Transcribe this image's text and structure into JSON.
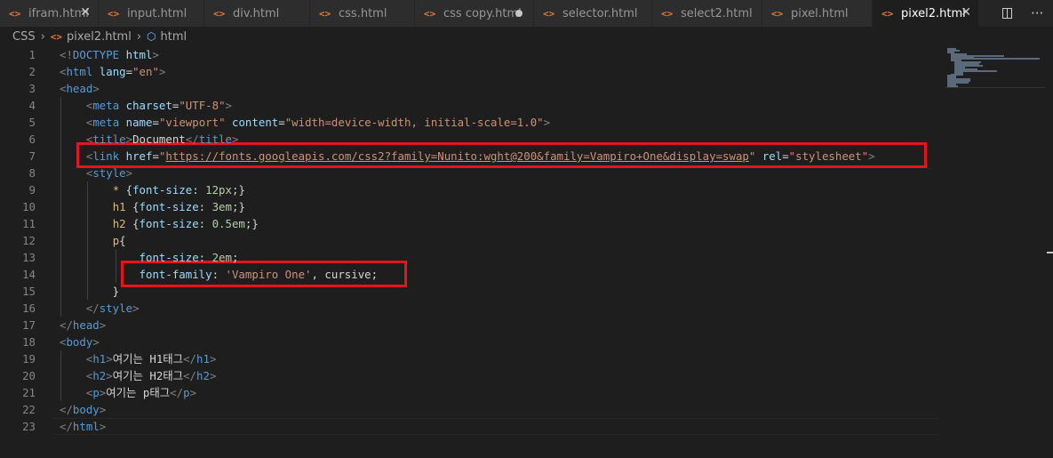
{
  "tabs": [
    {
      "label": "ifram.html",
      "icon": "html-icon",
      "state": "close",
      "width": 111
    },
    {
      "label": "input.html",
      "icon": "html-icon",
      "state": "",
      "width": 119
    },
    {
      "label": "div.html",
      "icon": "html-icon",
      "state": "",
      "width": 119
    },
    {
      "label": "css.html",
      "icon": "html-icon",
      "state": "",
      "width": 118
    },
    {
      "label": "css copy.html",
      "icon": "html-icon",
      "state": "dirty",
      "width": 134
    },
    {
      "label": "selector.html",
      "icon": "html-icon",
      "state": "",
      "width": 133
    },
    {
      "label": "select2.html",
      "icon": "html-icon",
      "state": "",
      "width": 124
    },
    {
      "label": "pixel.html",
      "icon": "html-icon",
      "state": "",
      "width": 124
    },
    {
      "label": "pixel2.html",
      "icon": "html-icon",
      "state": "active",
      "width": 120
    }
  ],
  "tab_close_glyph": "✕",
  "tab_more_glyph": "···",
  "breadcrumb": {
    "folder": "CSS",
    "file": "pixel2.html",
    "symbol": "html"
  },
  "lines": [
    [
      [
        "p",
        "<!"
      ],
      [
        "t",
        "DOCTYPE"
      ],
      [
        "x0",
        " "
      ],
      [
        "a",
        "html"
      ],
      [
        "p",
        ">"
      ]
    ],
    [
      [
        "p",
        "<"
      ],
      [
        "t",
        "html"
      ],
      [
        "x0",
        " "
      ],
      [
        "a",
        "lang"
      ],
      [
        "x0",
        "="
      ],
      [
        "s",
        "\"en\""
      ],
      [
        "p",
        ">"
      ]
    ],
    [
      [
        "p",
        "<"
      ],
      [
        "t",
        "head"
      ],
      [
        "p",
        ">"
      ]
    ],
    [
      [
        "x0",
        "    "
      ],
      [
        "p",
        "<"
      ],
      [
        "t",
        "meta"
      ],
      [
        "x0",
        " "
      ],
      [
        "a",
        "charset"
      ],
      [
        "x0",
        "="
      ],
      [
        "s",
        "\"UTF-8\""
      ],
      [
        "p",
        ">"
      ]
    ],
    [
      [
        "x0",
        "    "
      ],
      [
        "p",
        "<"
      ],
      [
        "t",
        "meta"
      ],
      [
        "x0",
        " "
      ],
      [
        "a",
        "name"
      ],
      [
        "x0",
        "="
      ],
      [
        "s",
        "\"viewport\""
      ],
      [
        "x0",
        " "
      ],
      [
        "a",
        "content"
      ],
      [
        "x0",
        "="
      ],
      [
        "s",
        "\"width=device-width, initial-scale=1.0\""
      ],
      [
        "p",
        ">"
      ]
    ],
    [
      [
        "x0",
        "    "
      ],
      [
        "p",
        "<"
      ],
      [
        "t",
        "title"
      ],
      [
        "p",
        ">"
      ],
      [
        "x0",
        "Document"
      ],
      [
        "p",
        "</"
      ],
      [
        "t",
        "title"
      ],
      [
        "p",
        ">"
      ]
    ],
    [
      [
        "x0",
        "    "
      ],
      [
        "p",
        "<"
      ],
      [
        "t",
        "link"
      ],
      [
        "x0",
        " "
      ],
      [
        "a",
        "href"
      ],
      [
        "x0",
        "="
      ],
      [
        "s",
        "\""
      ],
      [
        "su",
        "https://fonts.googleapis.com/css2?family=Nunito:wght@200&family=Vampiro+One&display=swap"
      ],
      [
        "s",
        "\""
      ],
      [
        "x0",
        " "
      ],
      [
        "a",
        "rel"
      ],
      [
        "x0",
        "="
      ],
      [
        "s",
        "\"stylesheet\""
      ],
      [
        "p",
        ">"
      ]
    ],
    [
      [
        "x0",
        "    "
      ],
      [
        "p",
        "<"
      ],
      [
        "t",
        "style"
      ],
      [
        "p",
        ">"
      ]
    ],
    [
      [
        "x0",
        "        "
      ],
      [
        "sel",
        "*"
      ],
      [
        "x0",
        " {"
      ],
      [
        "a",
        "font-size"
      ],
      [
        "x0",
        ": "
      ],
      [
        "n",
        "12px"
      ],
      [
        "x0",
        ";}"
      ]
    ],
    [
      [
        "x0",
        "        "
      ],
      [
        "sel",
        "h1"
      ],
      [
        "x0",
        " {"
      ],
      [
        "a",
        "font-size"
      ],
      [
        "x0",
        ": "
      ],
      [
        "n",
        "3em"
      ],
      [
        "x0",
        ";}"
      ]
    ],
    [
      [
        "x0",
        "        "
      ],
      [
        "sel",
        "h2"
      ],
      [
        "x0",
        " {"
      ],
      [
        "a",
        "font-size"
      ],
      [
        "x0",
        ": "
      ],
      [
        "n",
        "0.5em"
      ],
      [
        "x0",
        ";}"
      ]
    ],
    [
      [
        "x0",
        "        "
      ],
      [
        "sel",
        "p"
      ],
      [
        "x0",
        "{"
      ]
    ],
    [
      [
        "x0",
        "            "
      ],
      [
        "a",
        "font-size"
      ],
      [
        "x0",
        ": "
      ],
      [
        "n",
        "2em"
      ],
      [
        "x0",
        ";"
      ]
    ],
    [
      [
        "x0",
        "            "
      ],
      [
        "a",
        "font-family"
      ],
      [
        "x0",
        ": "
      ],
      [
        "s",
        "'Vampiro One'"
      ],
      [
        "x0",
        ", "
      ],
      [
        "s2",
        "cursive"
      ],
      [
        "x0",
        ";"
      ]
    ],
    [
      [
        "x0",
        "        }"
      ]
    ],
    [
      [
        "x0",
        "    "
      ],
      [
        "p",
        "</"
      ],
      [
        "t",
        "style"
      ],
      [
        "p",
        ">"
      ]
    ],
    [
      [
        "p",
        "</"
      ],
      [
        "t",
        "head"
      ],
      [
        "p",
        ">"
      ]
    ],
    [
      [
        "p",
        "<"
      ],
      [
        "t",
        "body"
      ],
      [
        "p",
        ">"
      ]
    ],
    [
      [
        "x0",
        "    "
      ],
      [
        "p",
        "<"
      ],
      [
        "t",
        "h1"
      ],
      [
        "p",
        ">"
      ],
      [
        "x0",
        "여기는 H1태그"
      ],
      [
        "p",
        "</"
      ],
      [
        "t",
        "h1"
      ],
      [
        "p",
        ">"
      ]
    ],
    [
      [
        "x0",
        "    "
      ],
      [
        "p",
        "<"
      ],
      [
        "t",
        "h2"
      ],
      [
        "p",
        ">"
      ],
      [
        "x0",
        "여기는 H2태그"
      ],
      [
        "p",
        "</"
      ],
      [
        "t",
        "h2"
      ],
      [
        "p",
        ">"
      ]
    ],
    [
      [
        "x0",
        "    "
      ],
      [
        "p",
        "<"
      ],
      [
        "t",
        "p"
      ],
      [
        "p",
        ">"
      ],
      [
        "x0",
        "여기는 p태그"
      ],
      [
        "p",
        "</"
      ],
      [
        "t",
        "p"
      ],
      [
        "p",
        ">"
      ]
    ],
    [
      [
        "p",
        "</"
      ],
      [
        "t",
        "body"
      ],
      [
        "p",
        ">"
      ]
    ],
    [
      [
        "p",
        "</"
      ],
      [
        "t",
        "html"
      ],
      [
        "p",
        ">"
      ]
    ]
  ],
  "colors": {
    "highlight_box": "#e8141c",
    "editor_bg": "#1e1e1e",
    "tab_bg": "#2d2d2d",
    "active_tab_bg": "#1e1e1e"
  }
}
